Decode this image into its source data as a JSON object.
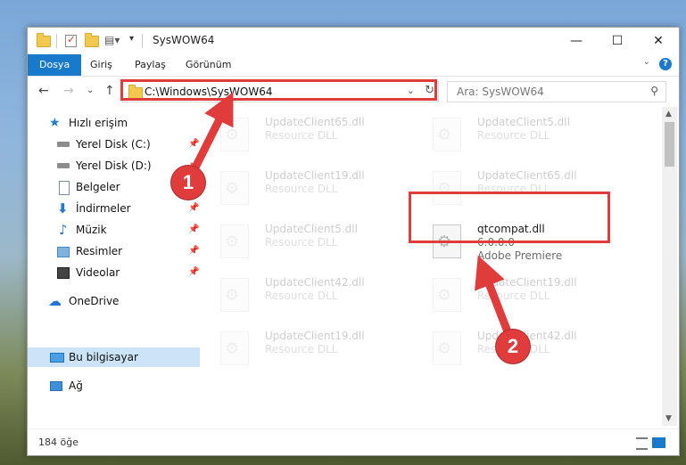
{
  "window": {
    "title": "SysWOW64",
    "controls": {
      "minimize": "—",
      "maximize": "☐",
      "close": "✕"
    }
  },
  "ribbon": {
    "tabs": [
      "Dosya",
      "Giriş",
      "Paylaş",
      "Görünüm"
    ],
    "active_tab": "Dosya",
    "accent": "#1979ca",
    "help": "?",
    "collapse": "⌄"
  },
  "nav": {
    "back": "←",
    "forward": "→",
    "recent": "⌄",
    "up": "↑",
    "address": "C:\\Windows\\SysWOW64",
    "address_chevron": "⌄",
    "refresh": "↻",
    "search_placeholder": "Ara: SysWOW64",
    "search_icon": "⚲"
  },
  "sidebar": {
    "items": [
      {
        "label": "Hızlı erişim",
        "icon": "star-icon",
        "glyph": "★",
        "pinned": false
      },
      {
        "label": "Yerel Disk (C:)",
        "icon": "drive-icon",
        "glyph": "",
        "pinned": true
      },
      {
        "label": "Yerel Disk (D:)",
        "icon": "drive-icon",
        "glyph": "",
        "pinned": true
      },
      {
        "label": "Belgeler",
        "icon": "documents-icon",
        "glyph": "",
        "pinned": true
      },
      {
        "label": "İndirmeler",
        "icon": "downloads-icon",
        "glyph": "⬇",
        "pinned": true
      },
      {
        "label": "Müzik",
        "icon": "music-icon",
        "glyph": "♪",
        "pinned": true
      },
      {
        "label": "Resimler",
        "icon": "pictures-icon",
        "glyph": "",
        "pinned": true
      },
      {
        "label": "Videolar",
        "icon": "videos-icon",
        "glyph": "",
        "pinned": true
      },
      {
        "label": "OneDrive",
        "icon": "onedrive-icon",
        "glyph": "☁",
        "pinned": false
      },
      {
        "label": "Bu bilgisayar",
        "icon": "computer-icon",
        "glyph": "",
        "pinned": false,
        "selected": true
      },
      {
        "label": "Ağ",
        "icon": "network-icon",
        "glyph": "",
        "pinned": false
      }
    ],
    "pin_glyph": "📌"
  },
  "files": [
    {
      "name": "UpdateClient65.dll",
      "type": "Resource DLL",
      "faded": true
    },
    {
      "name": "UpdateClient5.dll",
      "type": "Resource DLL",
      "faded": true
    },
    {
      "name": "UpdateClient19.dll",
      "type": "Resource DLL",
      "faded": true
    },
    {
      "name": "UpdateClient65.dll",
      "type": "Resource DLL",
      "faded": true
    },
    {
      "name": "UpdateClient5.dll",
      "type": "Resource DLL",
      "faded": true
    },
    {
      "name": "qtcompat.dll",
      "type": "6.0.0.0",
      "company": "Adobe Premiere",
      "faded": false,
      "highlighted": true
    },
    {
      "name": "UpdateClient42.dll",
      "type": "Resource DLL",
      "faded": true
    },
    {
      "name": "UpdateClient19.dll",
      "type": "Resource DLL",
      "faded": true
    },
    {
      "name": "UpdateClient19.dll",
      "type": "Resource DLL",
      "faded": true
    },
    {
      "name": "UpdateClient42.dll",
      "type": "Resource DLL",
      "faded": true
    }
  ],
  "status": {
    "item_count": "184 öğe"
  },
  "callouts": [
    {
      "number": "1",
      "color": "#e03c3c"
    },
    {
      "number": "2",
      "color": "#e03c3c"
    }
  ]
}
